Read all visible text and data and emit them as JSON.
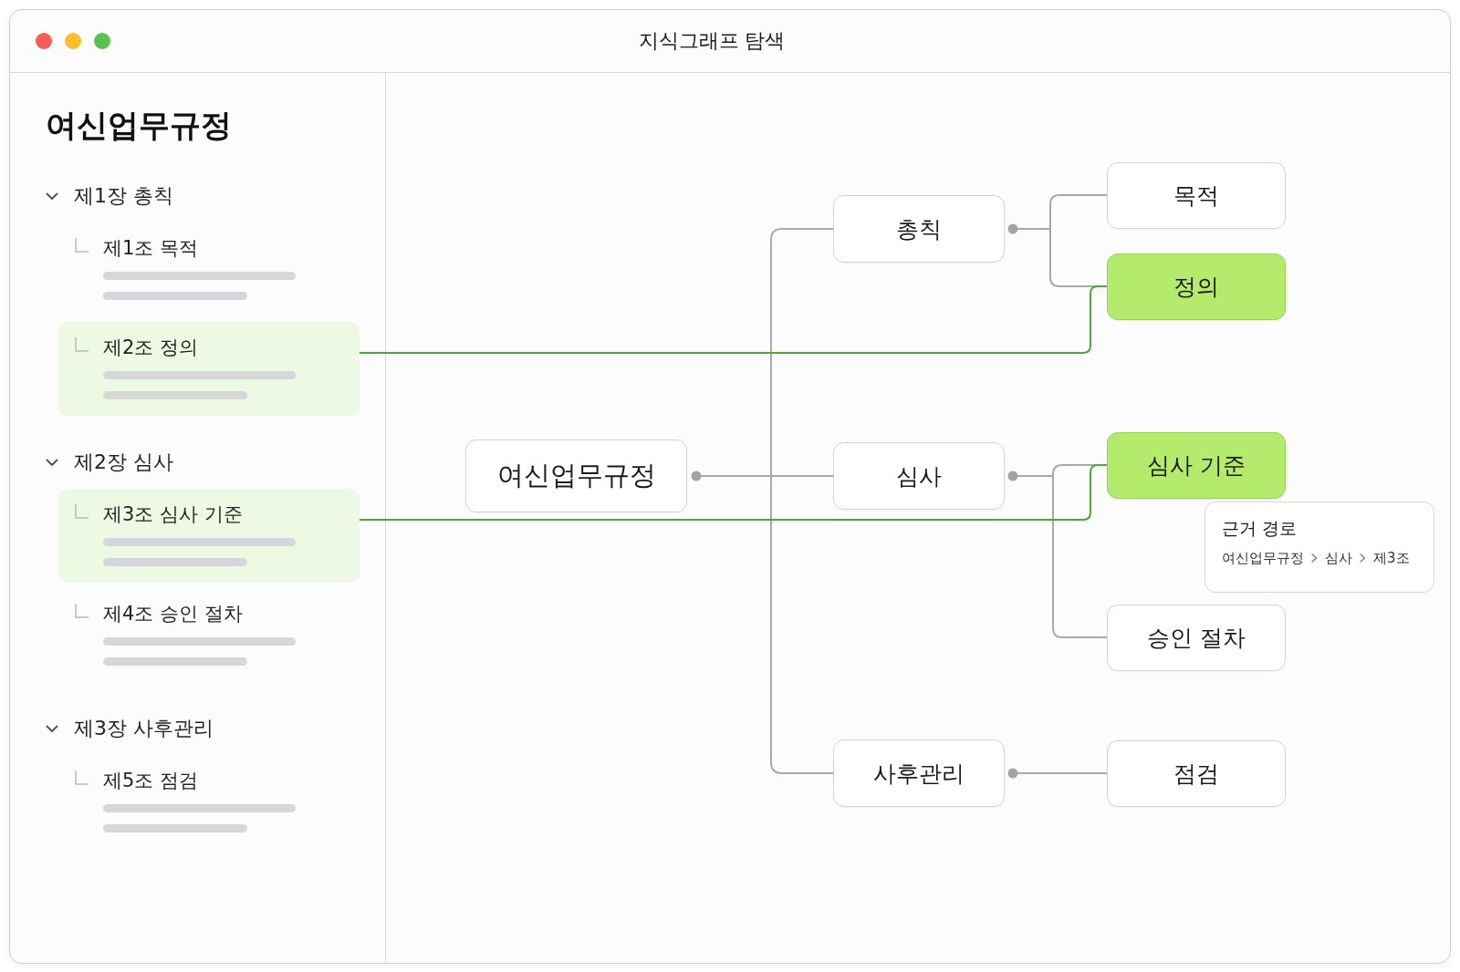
{
  "window": {
    "title": "지식그래프 탐색"
  },
  "sidebar": {
    "title": "여신업무규정",
    "chapters": [
      {
        "label": "제1장 총칙",
        "expanded": true,
        "articles": [
          {
            "label": "제1조 목적",
            "selected": false
          },
          {
            "label": "제2조 정의",
            "selected": true
          }
        ]
      },
      {
        "label": "제2장 심사",
        "expanded": true,
        "articles": [
          {
            "label": "제3조 심사 기준",
            "selected": true
          },
          {
            "label": "제4조 승인 절차",
            "selected": false
          }
        ]
      },
      {
        "label": "제3장 사후관리",
        "expanded": true,
        "articles": [
          {
            "label": "제5조 점검",
            "selected": false
          }
        ]
      }
    ]
  },
  "graph": {
    "root": {
      "label": "여신업무규정",
      "children": [
        {
          "label": "총칙",
          "highlighted": false,
          "children": [
            {
              "label": "목적",
              "highlighted": false
            },
            {
              "label": "정의",
              "highlighted": true
            }
          ]
        },
        {
          "label": "심사",
          "highlighted": false,
          "children": [
            {
              "label": "심사 기준",
              "highlighted": true,
              "tooltip": {
                "title": "근거 경로",
                "path": [
                  "여신업무규정",
                  "심사",
                  "제3조"
                ]
              }
            },
            {
              "label": "승인 절차",
              "highlighted": false
            }
          ]
        },
        {
          "label": "사후관리",
          "highlighted": false,
          "children": [
            {
              "label": "점검",
              "highlighted": false
            }
          ]
        }
      ]
    }
  }
}
